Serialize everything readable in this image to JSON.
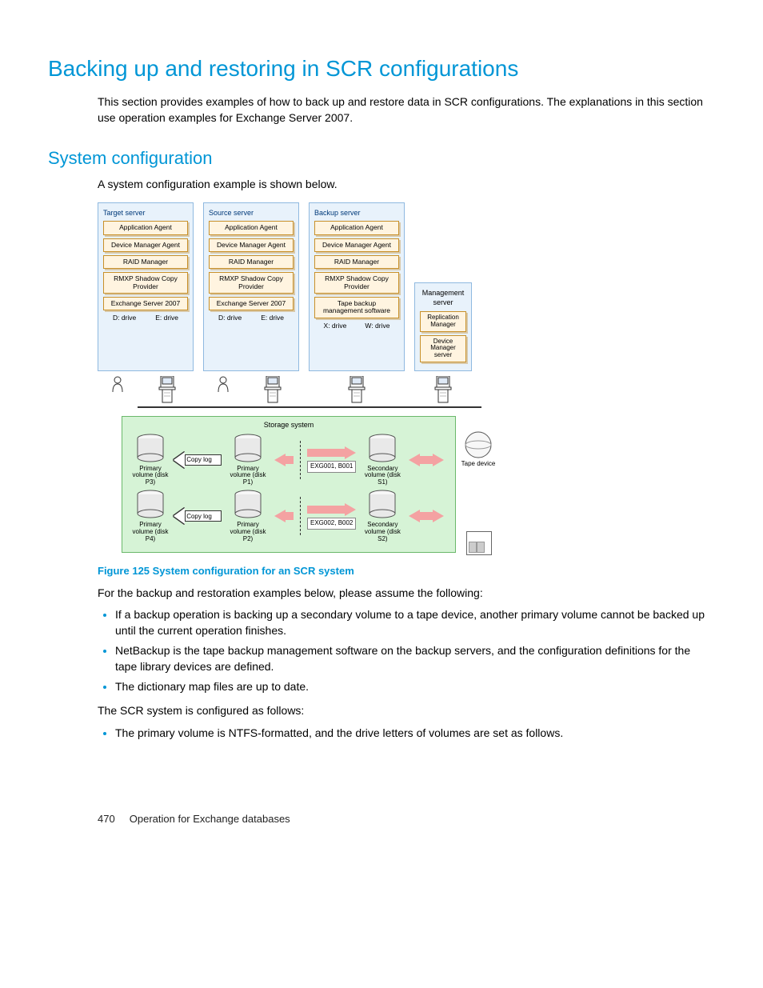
{
  "h1": "Backing up and restoring in SCR configurations",
  "intro": "This section provides examples of how to back up and restore data in SCR configurations. The explanations in this section use operation examples for Exchange Server 2007.",
  "h2": "System configuration",
  "sysconfig_lead": "A system configuration example is shown below.",
  "figure_caption": "Figure 125 System configuration for an SCR system",
  "assume_intro": "For the backup and restoration examples below, please assume the following:",
  "bullets": [
    "If a backup operation is backing up a secondary volume to a tape device, another primary volume cannot be backed up until the current operation finishes.",
    "NetBackup is the tape backup management software on the backup servers, and the configuration definitions for the tape library devices are defined.",
    "The dictionary map files are up to date."
  ],
  "scr_configured": "The SCR system is configured as follows:",
  "bullets2": [
    "The primary volume is NTFS-formatted, and the drive letters of volumes are set as follows."
  ],
  "footer_page": "470",
  "footer_title": "Operation for Exchange databases",
  "diagram": {
    "servers": {
      "target": {
        "title": "Target server",
        "boxes": [
          "Application Agent",
          "Device Manager Agent",
          "RAID Manager",
          "RMXP Shadow Copy Provider",
          "Exchange Server 2007"
        ],
        "drives": [
          "D: drive",
          "E: drive"
        ]
      },
      "source": {
        "title": "Source server",
        "boxes": [
          "Application Agent",
          "Device Manager Agent",
          "RAID Manager",
          "RMXP Shadow Copy Provider",
          "Exchange Server 2007"
        ],
        "drives": [
          "D: drive",
          "E: drive"
        ]
      },
      "backup": {
        "title": "Backup server",
        "boxes": [
          "Application Agent",
          "Device Manager Agent",
          "RAID Manager",
          "RMXP Shadow Copy Provider",
          "Tape backup management software"
        ],
        "drives": [
          "X: drive",
          "W: drive"
        ]
      },
      "management": {
        "title": "Management server",
        "boxes": [
          "Replication Manager",
          "Device Manager server"
        ]
      }
    },
    "storage": {
      "title": "Storage system",
      "copy_log": "Copy log",
      "tape": "Tape device",
      "rows": [
        {
          "pv_left": "Primary volume (disk P3)",
          "pv_mid": "Primary volume (disk P1)",
          "exg": "EXG001, B001",
          "sv": "Secondary volume (disk S1)"
        },
        {
          "pv_left": "Primary volume (disk P4)",
          "pv_mid": "Primary volume (disk P2)",
          "exg": "EXG002, B002",
          "sv": "Secondary volume (disk S2)"
        }
      ]
    }
  }
}
